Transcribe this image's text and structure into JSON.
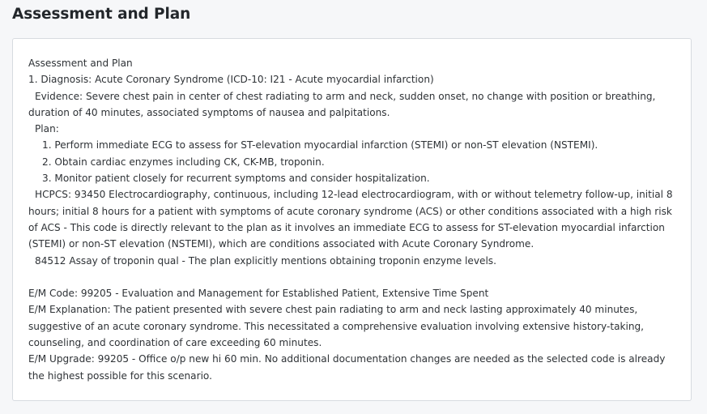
{
  "page": {
    "title": "Assessment and Plan"
  },
  "note": {
    "heading": "Assessment and Plan",
    "diagnosis": "1. Diagnosis: Acute Coronary Syndrome (ICD-10: I21 - Acute myocardial infarction)",
    "evidence": "Evidence: Severe chest pain in center of chest radiating to arm and neck, sudden onset, no change with position or breathing, duration of 40 minutes, associated symptoms of nausea and palpitations.",
    "plan_label": "Plan:",
    "plan_items": [
      "1. Perform immediate ECG to assess for ST-elevation myocardial infarction (STEMI) or non-ST elevation (NSTEMI).",
      "2. Obtain cardiac enzymes including CK, CK-MB, troponin.",
      "3. Monitor patient closely for recurrent symptoms and consider hospitalization."
    ],
    "hcpcs": "HCPCS: 93450 Electrocardiography, continuous, including 12-lead electrocardiogram, with or without telemetry follow-up, initial 8 hours; initial 8 hours for a patient with symptoms of acute coronary syndrome (ACS) or other conditions associated with a high risk of ACS - This code is directly relevant to the plan as it involves an immediate ECG to assess for ST-elevation myocardial infarction (STEMI) or non-ST elevation (NSTEMI), which are conditions associated with Acute Coronary Syndrome.",
    "hcpcs_2": "84512 Assay of troponin qual - The plan explicitly mentions obtaining troponin enzyme levels.",
    "em_code": "E/M Code: 99205 - Evaluation and Management for Established Patient, Extensive Time Spent",
    "em_explanation": "E/M Explanation: The patient presented with severe chest pain radiating to arm and neck lasting approximately 40 minutes, suggestive of an acute coronary syndrome. This necessitated a comprehensive evaluation involving extensive history-taking, counseling, and coordination of care exceeding 60 minutes.",
    "em_upgrade": "E/M Upgrade: 99205 - Office o/p new hi 60 min. No additional documentation changes are needed as the selected code is already the highest possible for this scenario."
  }
}
